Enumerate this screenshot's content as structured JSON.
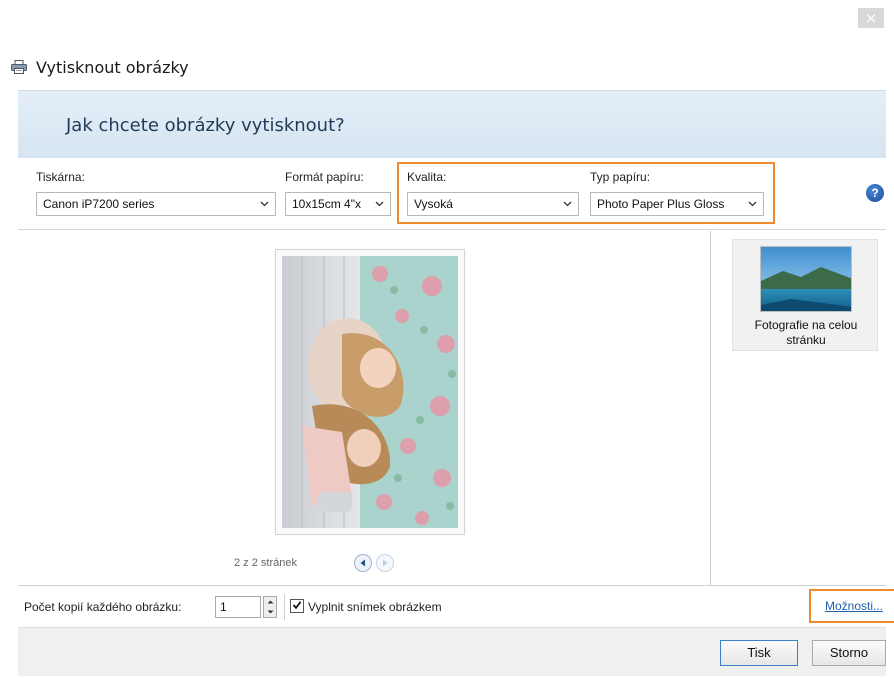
{
  "window": {
    "title": "Vytisknout obrázky",
    "close_glyph": "×"
  },
  "banner": {
    "prompt": "Jak chcete obrázky vytisknout?"
  },
  "settings": {
    "printer": {
      "label": "Tiskárna:",
      "value": "Canon iP7200 series"
    },
    "paper_size": {
      "label": "Formát papíru:",
      "value": "10x15cm 4\"x"
    },
    "quality": {
      "label": "Kvalita:",
      "value": "Vysoká"
    },
    "paper_type": {
      "label": "Typ papíru:",
      "value": "Photo Paper Plus Gloss"
    },
    "help_glyph": "?"
  },
  "preview": {
    "page_counter": "2 z 2 stránek"
  },
  "layouts": [
    {
      "label": "Fotografie na celou stránku",
      "selected": true
    }
  ],
  "options": {
    "copies_label": "Počet kopií každého obrázku:",
    "copies_value": "1",
    "fit_label": "Vyplnit snímek obrázkem",
    "fit_checked": true,
    "more_options_link": "Možnosti..."
  },
  "footer": {
    "print_button": "Tisk",
    "cancel_button": "Storno"
  },
  "icons": {
    "printer": "printer-icon",
    "close": "close-icon",
    "help": "help-icon",
    "chevron": "chevron-down-icon",
    "prev": "previous-page-icon",
    "next": "next-page-icon"
  },
  "colors": {
    "highlight": "#ef8a2e",
    "link": "#1e5fae",
    "banner": "#dbe8f4",
    "default_button_border": "#3c7fc9"
  }
}
